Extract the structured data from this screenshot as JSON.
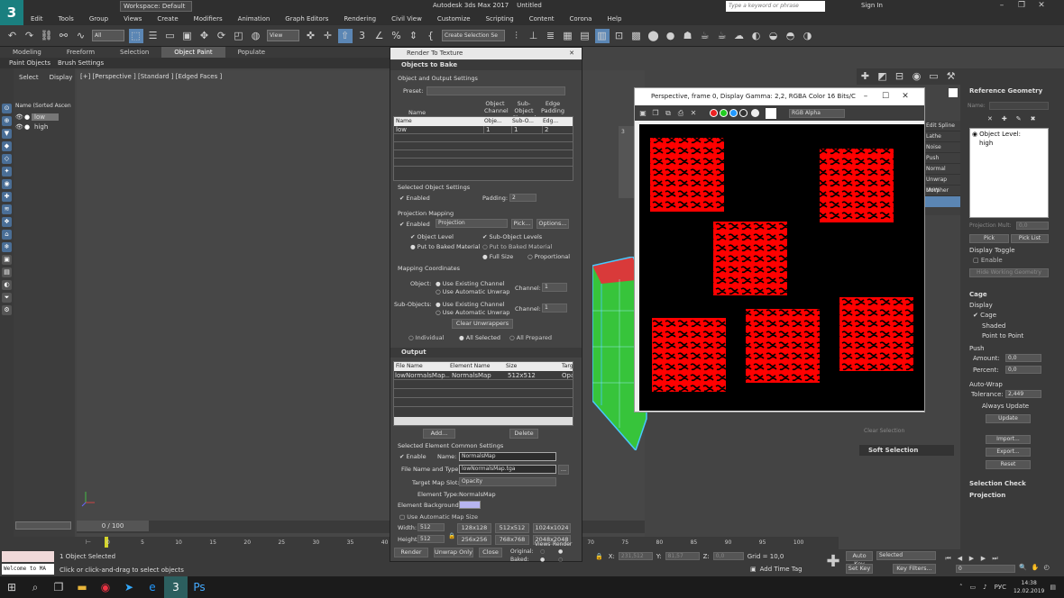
{
  "app": {
    "logo": "3",
    "title": "Autodesk 3ds Max 2017",
    "doc": "Untitled",
    "workspace": "Workspace: Default",
    "search_placeholder": "Type a keyword or phrase",
    "signin": "Sign In"
  },
  "menu": [
    "Edit",
    "Tools",
    "Group",
    "Views",
    "Create",
    "Modifiers",
    "Animation",
    "Graph Editors",
    "Rendering",
    "Civil View",
    "Customize",
    "Scripting",
    "Content",
    "Corona",
    "Help"
  ],
  "toolbar": {
    "selection_filter": "All",
    "view_dropdown": "View",
    "named_selection": "Create Selection Se"
  },
  "ribbon": {
    "tabs": [
      "Modeling",
      "Freeform",
      "Selection",
      "Object Paint",
      "Populate"
    ],
    "active": "Object Paint",
    "sub": [
      "Paint Objects",
      "Brush Settings"
    ]
  },
  "scene_explorer": {
    "tabs": [
      "Select",
      "Display"
    ],
    "header": "Name (Sorted Ascen",
    "items": [
      "low",
      "high"
    ]
  },
  "viewport": {
    "label": "[+] [Perspective ] [Standard ] [Edged Faces ]"
  },
  "timeline": {
    "slider": "0 / 100",
    "ticks": [
      "0",
      "5",
      "10",
      "15",
      "20",
      "25",
      "30",
      "35",
      "40",
      "45",
      "50",
      "55",
      "60",
      "65",
      "70",
      "75",
      "80",
      "85",
      "90",
      "95",
      "100"
    ]
  },
  "status": {
    "script": "Welcome to MA",
    "selected": "1 Object Selected",
    "prompt": "Click or click-and-drag to select objects",
    "x_label": "X:",
    "x": "231,512",
    "y_label": "Y:",
    "y": "81,57",
    "z_label": "Z:",
    "z": "0,0",
    "grid": "Grid = 10,0",
    "add_time_tag": "Add Time Tag",
    "auto_key": "Auto Key",
    "set_key": "Set Key",
    "selected_dd": "Selected",
    "key_filters": "Key Filters...",
    "frame": "0"
  },
  "rtt": {
    "title": "Render To Texture",
    "objects_to_bake": "Objects to Bake",
    "obj_output_settings": "Object and Output Settings",
    "preset_label": "Preset:",
    "cols_top": [
      "Object Channel",
      "Sub-Object Channel",
      "Edge Padding"
    ],
    "table_headers": [
      "Name",
      "Obje...",
      "Sub-O...",
      "Edg..."
    ],
    "table_row": {
      "name": "low",
      "obj": "1",
      "sub": "1",
      "edge": "2"
    },
    "sel_obj_settings": "Selected Object Settings",
    "enabled": "Enabled",
    "padding_label": "Padding:",
    "padding": "2",
    "projection_mapping": "Projection Mapping",
    "projection_dd": "Projection",
    "pick": "Pick...",
    "options": "Options...",
    "object_level": "Object Level",
    "sub_object_levels": "Sub-Object Levels",
    "put_to_baked": "Put to Baked Material",
    "full_size": "Full Size",
    "proportional": "Proportional",
    "mapping_coords": "Mapping Coordinates",
    "object_label": "Object:",
    "subobjects_label": "Sub-Objects:",
    "use_existing": "Use Existing Channel",
    "use_auto": "Use Automatic Unwrap",
    "channel_label": "Channel:",
    "channel": "1",
    "clear_unwrappers": "Clear Unwrappers",
    "individual": "Individual",
    "all_selected": "All Selected",
    "all_prepared": "All Prepared",
    "output": "Output",
    "out_headers": [
      "File Name",
      "Element Name",
      "Size",
      "Targ"
    ],
    "out_row": {
      "file": "lowNormalsMap....",
      "element": "NormalsMap",
      "size": "512x512",
      "target": "Opa"
    },
    "add": "Add...",
    "delete": "Delete",
    "sel_elem_common": "Selected Element Common Settings",
    "enable": "Enable",
    "name_label": "Name:",
    "name": "NormalsMap",
    "file_type_label": "File Name and Type:",
    "file": "lowNormalsMap.tga",
    "browse": "...",
    "target_slot_label": "Target Map Slot:",
    "target_slot": "Opacity",
    "element_type_label": "Element Type:",
    "element_type": "NormalsMap",
    "element_bg_label": "Element Background:",
    "use_auto_map_size": "Use Automatic Map Size",
    "width_label": "Width:",
    "width": "512",
    "height_label": "Height:",
    "height": "512",
    "sizes_row1": [
      "128x128",
      "512x512",
      "1024x1024"
    ],
    "sizes_row2": [
      "256x256",
      "768x768",
      "2048x2048"
    ],
    "render": "Render",
    "unwrap_only": "Unwrap Only",
    "close": "Close",
    "views": "Views",
    "render_col": "Render",
    "original": "Original:",
    "baked": "Baked:"
  },
  "framebuffer": {
    "title": "Perspective, frame 0, Display Gamma: 2,2, RGBA Color 16 Bits/Cha...",
    "channel_dd": "RGB Alpha"
  },
  "modifiers": [
    "Edit Spline",
    "Lathe",
    "Noise",
    "Push",
    "Normal",
    "Unwrap UVW",
    "Morpher"
  ],
  "cmd": {
    "ref_geom": "Reference Geometry",
    "name_placeholder": "Name:",
    "object_level": "Object Level:",
    "high": "high",
    "proj_mult": "Projection Mult:",
    "proj_mult_val": "0,0",
    "pick": "Pick",
    "pick_list": "Pick List",
    "display_toggle": "Display Toggle",
    "enable": "Enable",
    "hide_working": "Hide Working Geometry",
    "cage": "Cage",
    "display": "Display",
    "cage_chk": "Cage",
    "shaded": "Shaded",
    "point_to_point": "Point to Point",
    "push": "Push",
    "amount": "Amount:",
    "amount_val": "0,0",
    "percent": "Percent:",
    "percent_val": "0,0",
    "auto_wrap": "Auto-Wrap",
    "tolerance": "Tolerance:",
    "tolerance_val": "2,449",
    "always_update": "Always Update",
    "update": "Update",
    "import": "Import...",
    "export": "Export...",
    "reset": "Reset",
    "selection_check": "Selection Check",
    "projection": "Projection",
    "clear_selection": "Clear Selection",
    "soft_selection": "Soft Selection"
  },
  "taskbar": {
    "time": "14:38",
    "date": "12.02.2019",
    "lang": "РУС"
  },
  "colors": {
    "accent": "#5b86b4",
    "red": "#ff0000",
    "title_bg": "#2f2f2f"
  }
}
